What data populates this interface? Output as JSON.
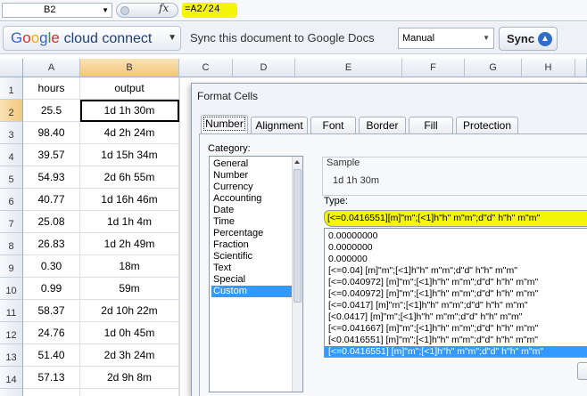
{
  "formula_bar": {
    "name_box": "B2",
    "fx": "fx",
    "formula": "=A2/24"
  },
  "google_toolbar": {
    "brand": "Google",
    "product": "cloud connect",
    "sync_text": "Sync this document to Google Docs",
    "mode_select": "Manual",
    "sync_button": "Sync"
  },
  "sheet": {
    "columns": [
      "A",
      "B",
      "C",
      "D",
      "E",
      "F",
      "G",
      "H"
    ],
    "rows": [
      {
        "num": "1",
        "a": "hours",
        "b": "output"
      },
      {
        "num": "2",
        "a": "25.5",
        "b": "1d 1h 30m"
      },
      {
        "num": "3",
        "a": "98.40",
        "b": "4d 2h 24m"
      },
      {
        "num": "4",
        "a": "39.57",
        "b": "1d 15h 34m"
      },
      {
        "num": "5",
        "a": "54.93",
        "b": "2d 6h 55m"
      },
      {
        "num": "6",
        "a": "40.77",
        "b": "1d 16h 46m"
      },
      {
        "num": "7",
        "a": "25.08",
        "b": "1d 1h 4m"
      },
      {
        "num": "8",
        "a": "26.83",
        "b": "1d 2h 49m"
      },
      {
        "num": "9",
        "a": "0.30",
        "b": "18m"
      },
      {
        "num": "10",
        "a": "0.99",
        "b": "59m"
      },
      {
        "num": "11",
        "a": "58.37",
        "b": "2d 10h 22m"
      },
      {
        "num": "12",
        "a": "24.76",
        "b": "1d 0h 45m"
      },
      {
        "num": "13",
        "a": "51.40",
        "b": "2d 3h 24m"
      },
      {
        "num": "14",
        "a": "57.13",
        "b": "2d 9h 8m"
      },
      {
        "num": "15",
        "a": "",
        "b": ""
      }
    ]
  },
  "dialog": {
    "title": "Format Cells",
    "tabs": [
      "Number",
      "Alignment",
      "Font",
      "Border",
      "Fill",
      "Protection"
    ],
    "category_label": "Category:",
    "categories": [
      "General",
      "Number",
      "Currency",
      "Accounting",
      "Date",
      "Time",
      "Percentage",
      "Fraction",
      "Scientific",
      "Text",
      "Special",
      "Custom"
    ],
    "selected_category": "Custom",
    "sample_label": "Sample",
    "sample_value": "1d 1h 30m",
    "type_label": "Type:",
    "type_value": "[<=0.0416551][m]\"m\";[<1]h\"h\" m\"m\";d\"d\" h\"h\" m\"m\"",
    "formats": [
      "0.00000000",
      "0.0000000",
      "0.000000",
      "[<=0.04] [m]\"m\";[<1]h\"h\" m\"m\";d\"d\" h\"h\" m\"m\"",
      "[<=0.040972] [m]\"m\";[<1]h\"h\" m\"m\";d\"d\" h\"h\" m\"m\"",
      "[<=0.040972] [m]\"m\";[<1]h\"h\" m\"m\";d\"d\" h\"h\" m\"m\"",
      "[<=0.0417] [m]\"m\";[<1]h\"h\" m\"m\";d\"d\" h\"h\" m\"m\"",
      "[<0.0417] [m]\"m\";[<1]h\"h\" m\"m\";d\"d\" h\"h\" m\"m\"",
      "[<=0.041667] [m]\"m\";[<1]h\"h\" m\"m\";d\"d\" h\"h\" m\"m\"",
      "[<0.0416551] [m]\"m\";[<1]h\"h\" m\"m\";d\"d\" h\"h\" m\"m\"",
      "[<=0.0416551] [m]\"m\";[<1]h\"h\" m\"m\";d\"d\" h\"h\" m\"m\""
    ],
    "selected_format_index": 10
  },
  "colors": {
    "highlight": "#f5f50a",
    "selection": "#3399ff",
    "header_selected": "#f2c77a"
  }
}
